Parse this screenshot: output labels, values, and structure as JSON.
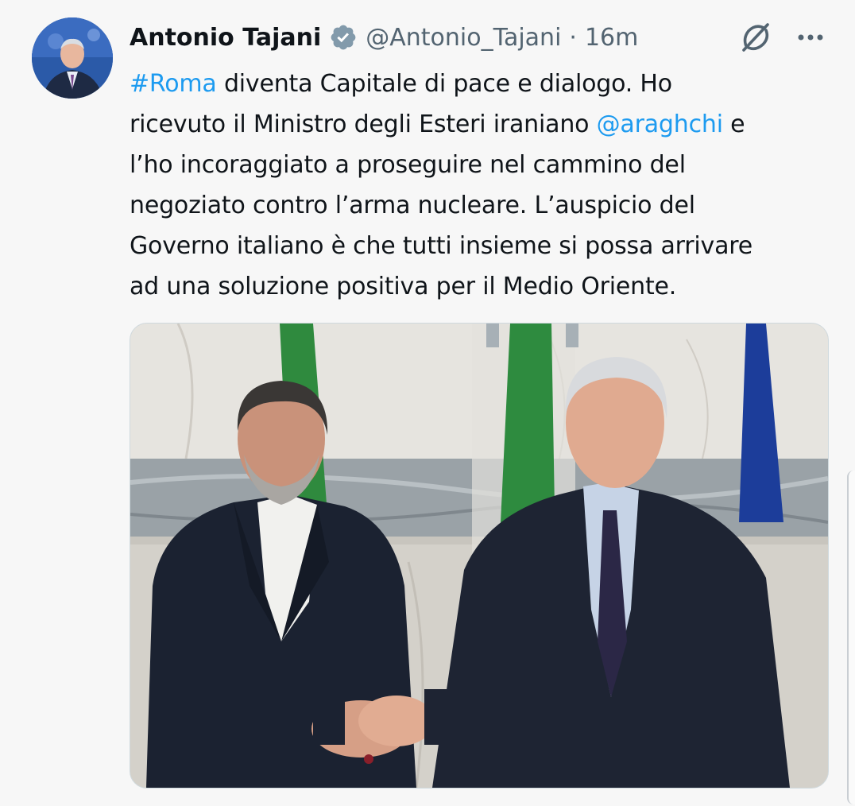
{
  "tweet": {
    "author_name": "Antonio Tajani",
    "handle": "@Antonio_Tajani",
    "separator": "·",
    "time": "16m",
    "text_lines": [
      [
        {
          "t": "#Roma",
          "link": true
        },
        {
          "t": " diventa Capitale di pace e dialogo. Ho",
          "link": false
        }
      ],
      [
        {
          "t": "ricevuto il Ministro degli Esteri iraniano ",
          "link": false
        },
        {
          "t": "@araghchi",
          "link": true
        },
        {
          "t": " e",
          "link": false
        }
      ],
      [
        {
          "t": "l’ho incoraggiato a proseguire nel cammino del",
          "link": false
        }
      ],
      [
        {
          "t": "negoziato contro l’arma nucleare. L’auspicio del",
          "link": false
        }
      ],
      [
        {
          "t": "Governo italiano è che tutti insieme si possa arrivare",
          "link": false
        }
      ],
      [
        {
          "t": "ad una soluzione positiva per il Medio Oriente.",
          "link": false
        }
      ]
    ],
    "icons": {
      "verified": "verified-badge-icon",
      "grok": "grok-icon",
      "more": "more-options-icon"
    }
  },
  "colors": {
    "link": "#1d9bf0",
    "secondary_text": "#536471",
    "verified_badge": "#829aab"
  }
}
